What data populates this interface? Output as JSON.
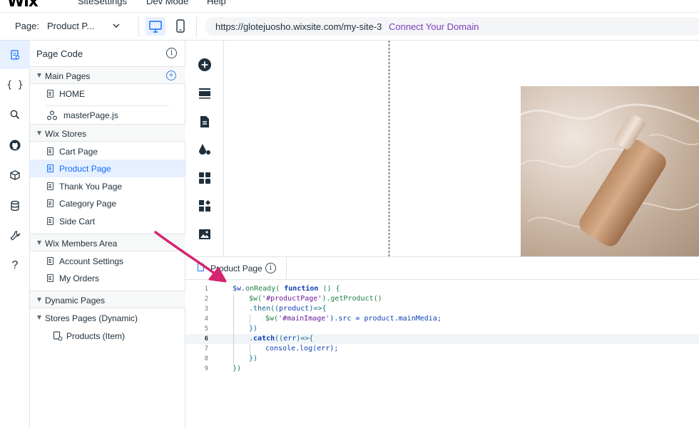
{
  "menubar": {
    "logo": "Wix",
    "items": [
      "Site",
      "Settings",
      "Dev Mode",
      "Help"
    ]
  },
  "toolbar": {
    "page_label": "Page:",
    "page_value": "Product P...",
    "url": "https://glotejuosho.wixsite.com/my-site-3",
    "connect_domain": "Connect Your Domain"
  },
  "rail": {
    "items": [
      "page-code-icon",
      "code-braces-icon",
      "search-icon",
      "github-icon",
      "packages-icon",
      "database-icon",
      "tools-icon",
      "help-icon"
    ],
    "braces": "{ }",
    "help": "?"
  },
  "panel": {
    "title": "Page Code",
    "info": "i",
    "sections": {
      "main_pages": "Main Pages",
      "wix_stores": "Wix Stores",
      "members": "Wix Members Area",
      "dynamic": "Dynamic Pages",
      "stores_dynamic": "Stores Pages (Dynamic)"
    },
    "files": {
      "home": "HOME",
      "master": "masterPage.js",
      "cart": "Cart Page",
      "product": "Product Page",
      "thank_you": "Thank You Page",
      "category": "Category Page",
      "side_cart": "Side Cart",
      "account": "Account Settings",
      "orders": "My Orders",
      "products_item": "Products (Item)"
    }
  },
  "editor": {
    "tab_label": "Product Page",
    "line_numbers": [
      "1",
      "2",
      "3",
      "4",
      "5",
      "6",
      "7",
      "8",
      "9"
    ],
    "code": {
      "l1_a": "$w",
      "l1_b": ".onReady( ",
      "l1_c": "function",
      "l1_d": " () {",
      "l2_a": "$w(",
      "l2_b": "'#productPage'",
      "l2_c": ").getProduct()",
      "l3_a": ".then((",
      "l3_b": "product",
      "l3_c": ")=>{",
      "l4_a": "$w(",
      "l4_b": "'#mainImage'",
      "l4_c": ").src = product.mainMedia;",
      "l5": "})",
      "l6_a": ".",
      "l6_b": "catch",
      "l6_c": "((",
      "l6_d": "err",
      "l6_e": ")=>{",
      "l7": "console.log(err);",
      "l8": "})",
      "l9": "})"
    }
  },
  "colors": {
    "accent": "#116dff",
    "active_bg": "#e7f0ff",
    "connect": "#7a3fc0",
    "arrow": "#d6246e"
  }
}
